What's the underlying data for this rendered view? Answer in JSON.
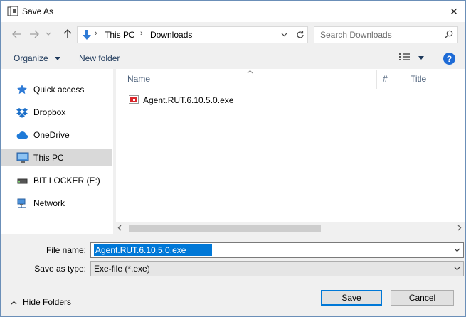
{
  "window": {
    "title": "Save As",
    "close_glyph": "✕"
  },
  "address_bar": {
    "crumbs": [
      "This PC",
      "Downloads"
    ],
    "separator": "›",
    "search_placeholder": "Search Downloads"
  },
  "toolbar": {
    "organize_label": "Organize",
    "new_folder_label": "New folder",
    "help_label": "?"
  },
  "nav_pane": {
    "items": [
      {
        "label": "Quick access",
        "icon": "star-icon"
      },
      {
        "label": "Dropbox",
        "icon": "dropbox-icon"
      },
      {
        "label": "OneDrive",
        "icon": "cloud-icon"
      },
      {
        "label": "This PC",
        "icon": "computer-icon",
        "selected": true
      },
      {
        "label": "BIT LOCKER (E:)",
        "icon": "drive-icon"
      },
      {
        "label": "Network",
        "icon": "network-icon"
      }
    ]
  },
  "file_list": {
    "columns": [
      "Name",
      "#",
      "Title"
    ],
    "files": [
      {
        "name": "Agent.RUT.6.10.5.0.exe",
        "icon": "exe-file-icon"
      }
    ]
  },
  "form": {
    "filename_label": "File name:",
    "filename_value": "Agent.RUT.6.10.5.0.exe",
    "savetype_label": "Save as type:",
    "savetype_value": "Exe-file (*.exe)"
  },
  "footer": {
    "hide_folders_label": "Hide Folders",
    "save_label": "Save",
    "cancel_label": "Cancel"
  },
  "colors": {
    "accent": "#0078d7",
    "selection": "#d9d9d9",
    "help": "#1e6bd6"
  }
}
